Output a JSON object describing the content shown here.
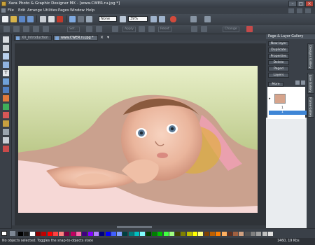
{
  "window": {
    "title": "Xara Photo & Graphic Designer MX - [www.CWER.ru.jpg *]",
    "controls": [
      "–",
      "□",
      "×"
    ]
  },
  "menu": [
    "File",
    "Edit",
    "Arrange",
    "Utilities",
    "Pages",
    "Window",
    "Help"
  ],
  "toolbar": {
    "quality": "None",
    "zoom": "39%",
    "row2_ghosts": [
      "Set...",
      "Apply",
      "Reset",
      "Change"
    ]
  },
  "tabs": [
    {
      "label": "XX_Introduction",
      "active": false
    },
    {
      "label": "www.CWER.ru.jpg *",
      "active": true
    }
  ],
  "right_panel": {
    "title": "Page & Layer Gallery",
    "buttons": [
      "New layer",
      "Duplicate",
      "Properties",
      "Delete",
      "Paged",
      "Layers"
    ],
    "more": "More",
    "layers": [
      {
        "label": "1",
        "selected": false
      },
      {
        "label": "1",
        "selected": true
      },
      {
        "label": "",
        "selected": false
      }
    ],
    "vertical_tabs": [
      "Designs Gallery",
      "Line Gallery",
      "Frame Gallery"
    ]
  },
  "palette": [
    "#000000",
    "#1a1a1a",
    "#ffffff",
    "#8b0000",
    "#c00000",
    "#ff0000",
    "#ff4040",
    "#ff8080",
    "#800040",
    "#c00060",
    "#ff66aa",
    "#400080",
    "#8000ff",
    "#b080ff",
    "#000080",
    "#0000ff",
    "#4060ff",
    "#80a0ff",
    "#004040",
    "#008080",
    "#00c0c0",
    "#80ffff",
    "#004000",
    "#008000",
    "#00c000",
    "#40ff40",
    "#a0ff80",
    "#404000",
    "#808000",
    "#c0c000",
    "#ffff00",
    "#ffff80",
    "#804000",
    "#c06000",
    "#ff8000",
    "#ffb060",
    "#603020",
    "#a06040",
    "#d0a080",
    "#505050",
    "#808080",
    "#a0a0a0",
    "#c0c0c0",
    "#e0e0e0"
  ],
  "status": {
    "message": "No objects selected: Toggles the snap-to-objects state",
    "readout": "1460, 19 Kbs"
  }
}
